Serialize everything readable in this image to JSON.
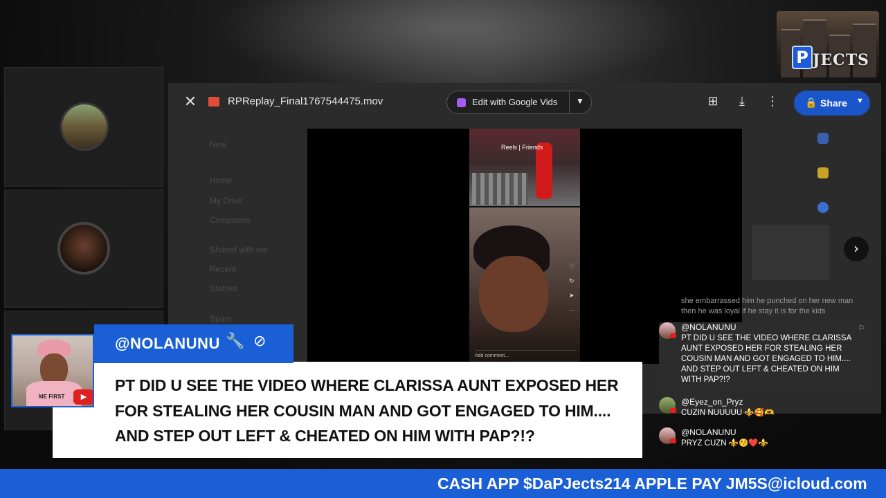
{
  "viewer": {
    "file_name": "RPReplay_Final1767544475.mov",
    "edit_button_label": "Edit with Google Vids",
    "share_label": "Share",
    "drive_sidebar": [
      "New",
      "Home",
      "My Drive",
      "Computers",
      "Shared with me",
      "Recent",
      "Starred",
      "Spam"
    ]
  },
  "phone_video": {
    "tabs_label": "Reels | Friends",
    "comment_placeholder": "Add comment..."
  },
  "overlay": {
    "username": "@NOLANUNU",
    "comment": "PT DID U SEE THE VIDEO WHERE CLARISSA AUNT EXPOSED HER FOR STEALING HER COUSIN MAN AND GOT ENGAGED TO HIM.... AND STEP OUT LEFT & CHEATED ON HIM WITH PAP?!?",
    "pfp_shirt_text": "ME FIRST"
  },
  "chat": {
    "faded_message": "she embarrassed him he punched on her new man then he was loyal if he stay it is for the kids",
    "messages": [
      {
        "user": "@NOLANUNU",
        "text": "PT DID U SEE THE VIDEO WHERE CLARISSA AUNT EXPOSED HER FOR STEALING HER COUSIN MAN AND GOT ENGAGED TO HIM.... AND STEP OUT LEFT & CHEATED ON HIM WITH PAP?!?"
      },
      {
        "user": "@Eyez_on_Pryz",
        "text": "CUZIN NUUUUU ⚜️🥰🫶"
      },
      {
        "user": "@NOLANUNU",
        "text": "PRYZ CUZN ⚜️😚❤️⚜️"
      }
    ]
  },
  "ticker": {
    "text": "CASH APP $DaPJects214 APPLE PAY JM5S@icloud.com"
  },
  "logo": {
    "letter": "P",
    "word": "JECTS"
  },
  "colors": {
    "brand_blue": "#1a5fd6",
    "share_blue": "#1a56c8",
    "youtube_red": "#e02020"
  }
}
